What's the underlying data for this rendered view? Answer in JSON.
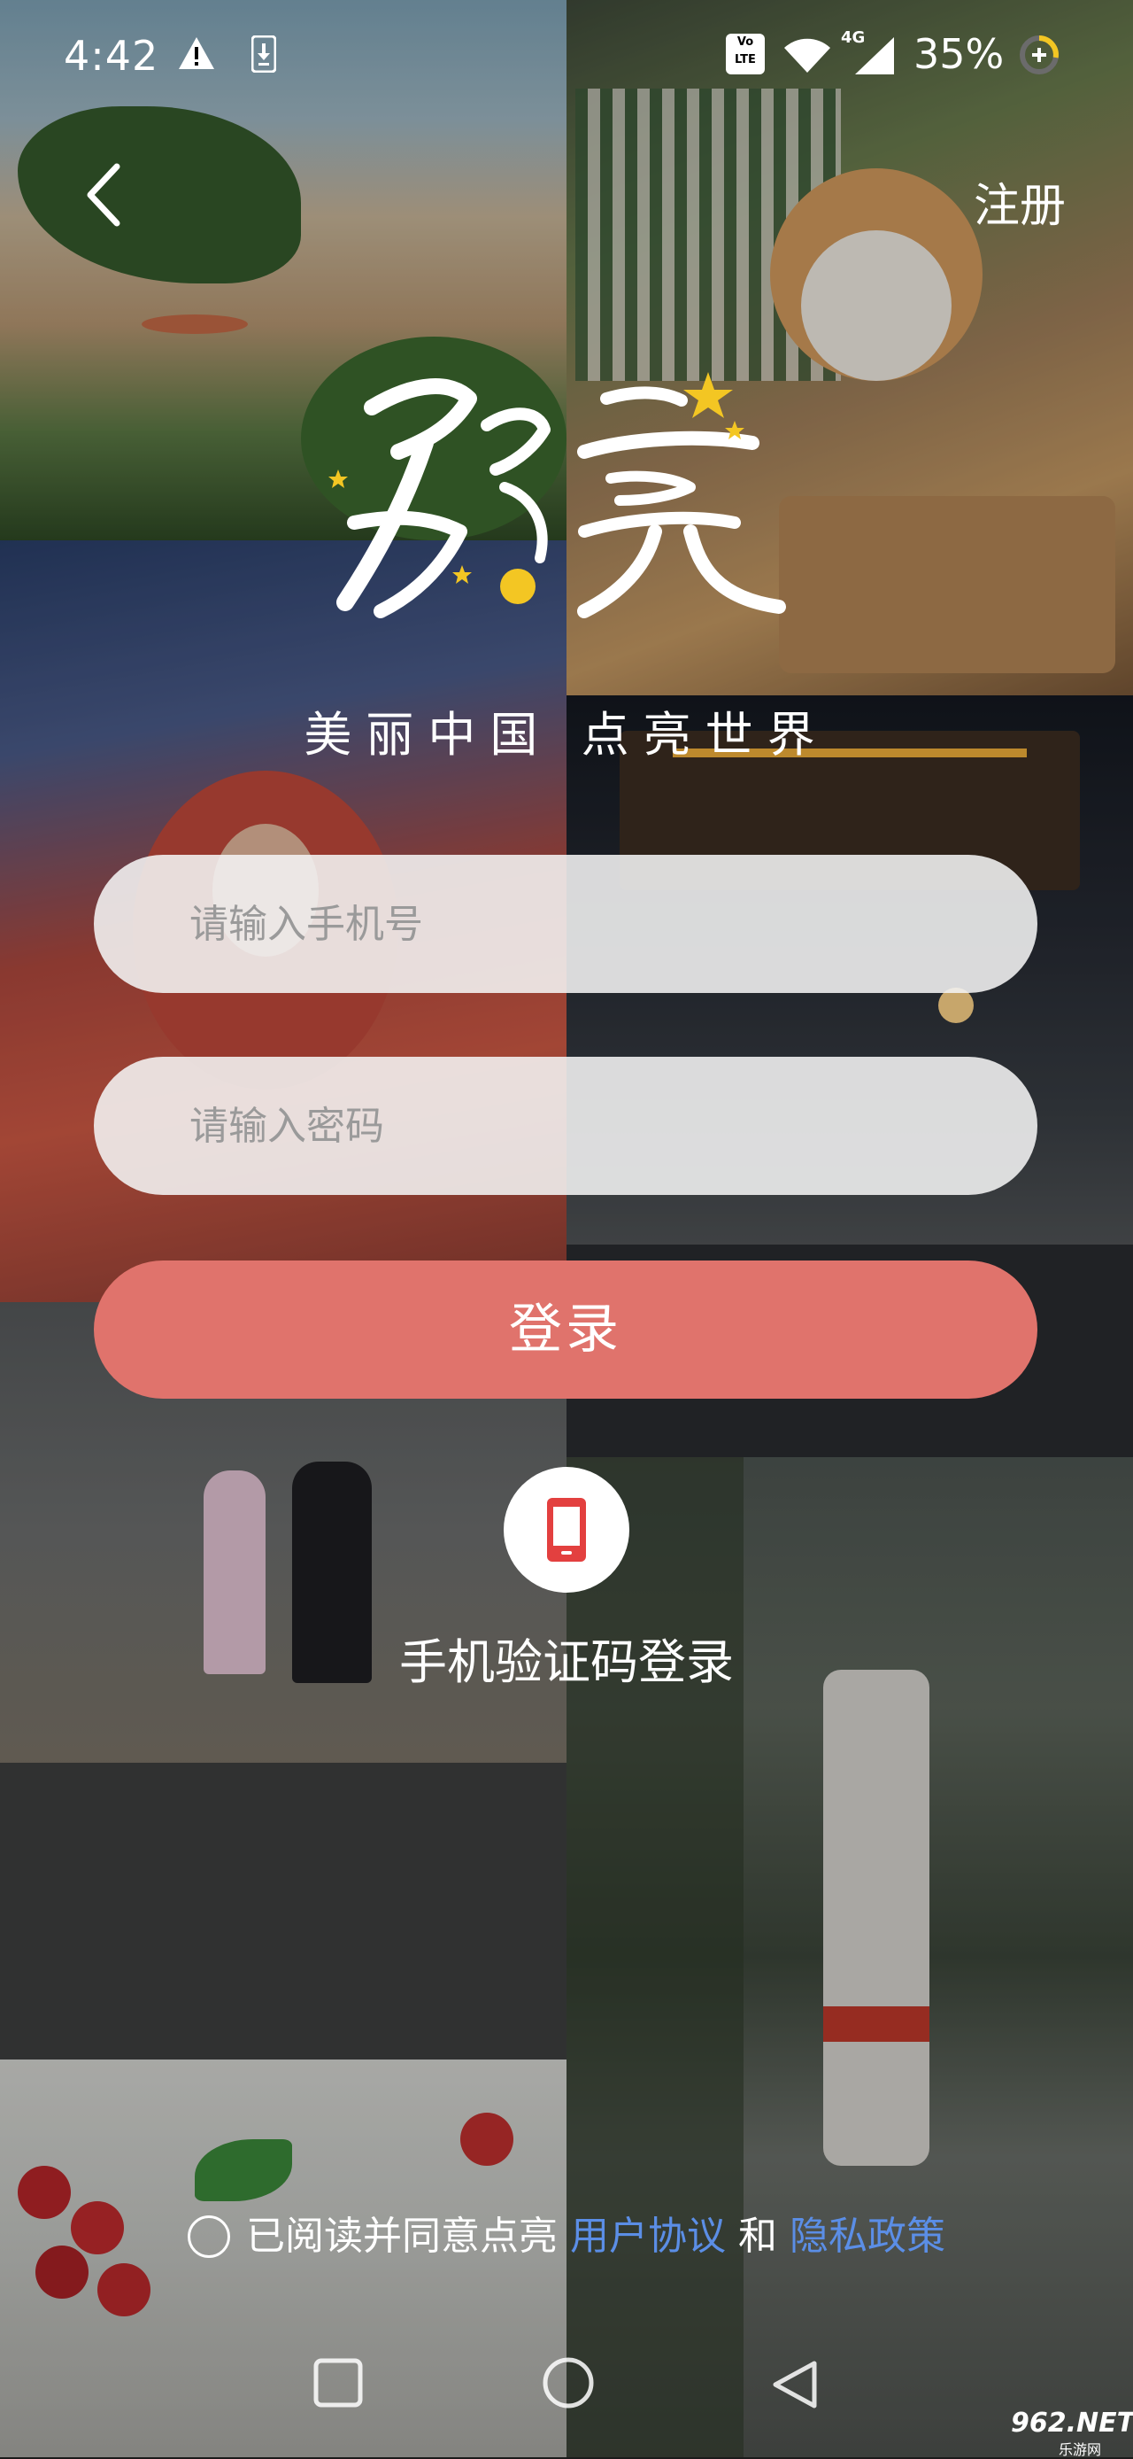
{
  "status_bar": {
    "time": "4:42",
    "volte": "Vo LTE",
    "network": "4G",
    "battery": "35%"
  },
  "header": {
    "register": "注册"
  },
  "slogan": "美丽中国  点亮世界",
  "form": {
    "phone_placeholder": "请输入手机号",
    "password_placeholder": "请输入密码",
    "login_label": "登录"
  },
  "sms_login_label": "手机验证码登录",
  "agreement": {
    "prefix": "已阅读并同意点亮",
    "user_agreement": "用户协议",
    "connector": "和",
    "privacy_policy": "隐私政策"
  },
  "watermark": {
    "text": "962.NET",
    "sub": "乐游网"
  },
  "colors": {
    "login_button": "#e0736c",
    "link": "#5b8ee6",
    "logo_star": "#f3c623"
  },
  "icons": [
    "warning-icon",
    "download-icon",
    "wifi-icon",
    "signal-icon",
    "battery-icon",
    "back-chevron-icon",
    "phone-icon",
    "nav-recent-icon",
    "nav-home-icon",
    "nav-back-icon"
  ]
}
